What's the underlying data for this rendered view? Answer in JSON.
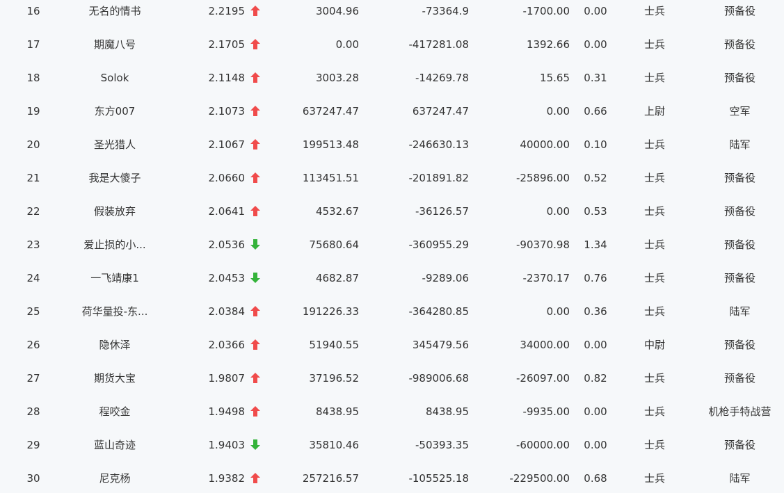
{
  "colors": {
    "up": "#f04b4b",
    "down": "#34b33a",
    "text": "#333333",
    "background": "#f6f8fa"
  },
  "rows": [
    {
      "rank": "16",
      "name": "无名的情书",
      "score": "2.2195",
      "trend": "up",
      "col_a": "3004.96",
      "col_b": "-73364.9",
      "col_c": "-1700.00",
      "col_d": "0.00",
      "title": "士兵",
      "unit": "预备役"
    },
    {
      "rank": "17",
      "name": "期魔八号",
      "score": "2.1705",
      "trend": "up",
      "col_a": "0.00",
      "col_b": "-417281.08",
      "col_c": "1392.66",
      "col_d": "0.00",
      "title": "士兵",
      "unit": "预备役"
    },
    {
      "rank": "18",
      "name": "Solok",
      "score": "2.1148",
      "trend": "up",
      "col_a": "3003.28",
      "col_b": "-14269.78",
      "col_c": "15.65",
      "col_d": "0.31",
      "title": "士兵",
      "unit": "预备役"
    },
    {
      "rank": "19",
      "name": "东方007",
      "score": "2.1073",
      "trend": "up",
      "col_a": "637247.47",
      "col_b": "637247.47",
      "col_c": "0.00",
      "col_d": "0.66",
      "title": "上尉",
      "unit": "空军"
    },
    {
      "rank": "20",
      "name": "圣光猎人",
      "score": "2.1067",
      "trend": "up",
      "col_a": "199513.48",
      "col_b": "-246630.13",
      "col_c": "40000.00",
      "col_d": "0.10",
      "title": "士兵",
      "unit": "陆军"
    },
    {
      "rank": "21",
      "name": "我是大傻子",
      "score": "2.0660",
      "trend": "up",
      "col_a": "113451.51",
      "col_b": "-201891.82",
      "col_c": "-25896.00",
      "col_d": "0.52",
      "title": "士兵",
      "unit": "预备役"
    },
    {
      "rank": "22",
      "name": "假装放弃",
      "score": "2.0641",
      "trend": "up",
      "col_a": "4532.67",
      "col_b": "-36126.57",
      "col_c": "0.00",
      "col_d": "0.53",
      "title": "士兵",
      "unit": "预备役"
    },
    {
      "rank": "23",
      "name": "爱止损的小...",
      "score": "2.0536",
      "trend": "down",
      "col_a": "75680.64",
      "col_b": "-360955.29",
      "col_c": "-90370.98",
      "col_d": "1.34",
      "title": "士兵",
      "unit": "预备役"
    },
    {
      "rank": "24",
      "name": "一飞靖康1",
      "score": "2.0453",
      "trend": "down",
      "col_a": "4682.87",
      "col_b": "-9289.06",
      "col_c": "-2370.17",
      "col_d": "0.76",
      "title": "士兵",
      "unit": "预备役"
    },
    {
      "rank": "25",
      "name": "荷华量投-东...",
      "score": "2.0384",
      "trend": "up",
      "col_a": "191226.33",
      "col_b": "-364280.85",
      "col_c": "0.00",
      "col_d": "0.36",
      "title": "士兵",
      "unit": "陆军"
    },
    {
      "rank": "26",
      "name": "隐休泽",
      "score": "2.0366",
      "trend": "up",
      "col_a": "51940.55",
      "col_b": "345479.56",
      "col_c": "34000.00",
      "col_d": "0.00",
      "title": "中尉",
      "unit": "预备役"
    },
    {
      "rank": "27",
      "name": "期货大宝",
      "score": "1.9807",
      "trend": "up",
      "col_a": "37196.52",
      "col_b": "-989006.68",
      "col_c": "-26097.00",
      "col_d": "0.82",
      "title": "士兵",
      "unit": "预备役"
    },
    {
      "rank": "28",
      "name": "程咬金",
      "score": "1.9498",
      "trend": "up",
      "col_a": "8438.95",
      "col_b": "8438.95",
      "col_c": "-9935.00",
      "col_d": "0.00",
      "title": "士兵",
      "unit": "机枪手特战营"
    },
    {
      "rank": "29",
      "name": "蓝山奇迹",
      "score": "1.9403",
      "trend": "down",
      "col_a": "35810.46",
      "col_b": "-50393.35",
      "col_c": "-60000.00",
      "col_d": "0.00",
      "title": "士兵",
      "unit": "预备役"
    },
    {
      "rank": "30",
      "name": "尼克杨",
      "score": "1.9382",
      "trend": "up",
      "col_a": "257216.57",
      "col_b": "-105525.18",
      "col_c": "-229500.00",
      "col_d": "0.68",
      "title": "士兵",
      "unit": "陆军"
    }
  ]
}
